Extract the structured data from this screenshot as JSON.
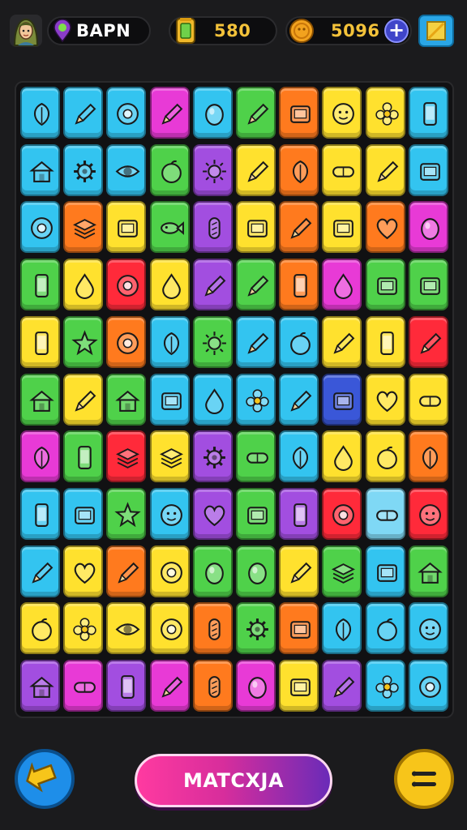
{
  "header": {
    "player_name": "BAPN",
    "gems": "580",
    "coins": "5096",
    "avatar_icon": "avatar-girl-icon",
    "gem_icon": "gem-jar-icon",
    "coin_icon": "coin-icon",
    "plus_icon": "plus-icon",
    "shop_icon": "square-shop-icon"
  },
  "board": {
    "rows": 11,
    "cols": 10,
    "tiles": [
      {
        "color": "#33c4f0",
        "icon": "leaf"
      },
      {
        "color": "#33c4f0",
        "icon": "pencil"
      },
      {
        "color": "#33c4f0",
        "icon": "donut"
      },
      {
        "color": "#e83ad6",
        "icon": "pencil"
      },
      {
        "color": "#33c4f0",
        "icon": "egg"
      },
      {
        "color": "#4fd14a",
        "icon": "pencil"
      },
      {
        "color": "#ff7a1e",
        "icon": "box"
      },
      {
        "color": "#ffe12e",
        "icon": "face"
      },
      {
        "color": "#ffe12e",
        "icon": "flower"
      },
      {
        "color": "#33c4f0",
        "icon": "phone"
      },
      {
        "color": "#33c4f0",
        "icon": "house"
      },
      {
        "color": "#33c4f0",
        "icon": "gear"
      },
      {
        "color": "#33c4f0",
        "icon": "eye"
      },
      {
        "color": "#4fd14a",
        "icon": "apple"
      },
      {
        "color": "#a24ee0",
        "icon": "sun"
      },
      {
        "color": "#ffe12e",
        "icon": "pencil"
      },
      {
        "color": "#ff7a1e",
        "icon": "leaf"
      },
      {
        "color": "#ffe12e",
        "icon": "capsule"
      },
      {
        "color": "#ffe12e",
        "icon": "pencil"
      },
      {
        "color": "#33c4f0",
        "icon": "box"
      },
      {
        "color": "#33c4f0",
        "icon": "donut"
      },
      {
        "color": "#ff7a1e",
        "icon": "layers"
      },
      {
        "color": "#ffe12e",
        "icon": "box"
      },
      {
        "color": "#4fd14a",
        "icon": "fish"
      },
      {
        "color": "#a24ee0",
        "icon": "bread"
      },
      {
        "color": "#ffe12e",
        "icon": "box"
      },
      {
        "color": "#ff7a1e",
        "icon": "pencil"
      },
      {
        "color": "#ffe12e",
        "icon": "box"
      },
      {
        "color": "#ff7a1e",
        "icon": "heart"
      },
      {
        "color": "#e83ad6",
        "icon": "egg"
      },
      {
        "color": "#4fd14a",
        "icon": "phone"
      },
      {
        "color": "#ffe12e",
        "icon": "drop"
      },
      {
        "color": "#ff2a3a",
        "icon": "donut"
      },
      {
        "color": "#ffe12e",
        "icon": "drop"
      },
      {
        "color": "#a24ee0",
        "icon": "pencil"
      },
      {
        "color": "#4fd14a",
        "icon": "pencil"
      },
      {
        "color": "#ff7a1e",
        "icon": "phone"
      },
      {
        "color": "#e83ad6",
        "icon": "drop"
      },
      {
        "color": "#4fd14a",
        "icon": "box"
      },
      {
        "color": "#4fd14a",
        "icon": "box"
      },
      {
        "color": "#ffe12e",
        "icon": "phone"
      },
      {
        "color": "#4fd14a",
        "icon": "star"
      },
      {
        "color": "#ff7a1e",
        "icon": "donut"
      },
      {
        "color": "#33c4f0",
        "icon": "leaf"
      },
      {
        "color": "#4fd14a",
        "icon": "sun"
      },
      {
        "color": "#33c4f0",
        "icon": "pencil"
      },
      {
        "color": "#33c4f0",
        "icon": "apple"
      },
      {
        "color": "#ffe12e",
        "icon": "pencil"
      },
      {
        "color": "#ffe12e",
        "icon": "phone"
      },
      {
        "color": "#ff2a3a",
        "icon": "pencil"
      },
      {
        "color": "#4fd14a",
        "icon": "house"
      },
      {
        "color": "#ffe12e",
        "icon": "pencil"
      },
      {
        "color": "#4fd14a",
        "icon": "house"
      },
      {
        "color": "#33c4f0",
        "icon": "box"
      },
      {
        "color": "#33c4f0",
        "icon": "drop"
      },
      {
        "color": "#33c4f0",
        "icon": "flower"
      },
      {
        "color": "#33c4f0",
        "icon": "pencil"
      },
      {
        "color": "#3a57d8",
        "icon": "box"
      },
      {
        "color": "#ffe12e",
        "icon": "heart"
      },
      {
        "color": "#ffe12e",
        "icon": "capsule"
      },
      {
        "color": "#e83ad6",
        "icon": "leaf"
      },
      {
        "color": "#4fd14a",
        "icon": "phone"
      },
      {
        "color": "#ff2a3a",
        "icon": "layers"
      },
      {
        "color": "#ffe12e",
        "icon": "layers"
      },
      {
        "color": "#a24ee0",
        "icon": "gear"
      },
      {
        "color": "#4fd14a",
        "icon": "capsule"
      },
      {
        "color": "#33c4f0",
        "icon": "leaf"
      },
      {
        "color": "#ffe12e",
        "icon": "drop"
      },
      {
        "color": "#ffe12e",
        "icon": "apple"
      },
      {
        "color": "#ff7a1e",
        "icon": "leaf"
      },
      {
        "color": "#33c4f0",
        "icon": "phone"
      },
      {
        "color": "#33c4f0",
        "icon": "box"
      },
      {
        "color": "#4fd14a",
        "icon": "star"
      },
      {
        "color": "#33c4f0",
        "icon": "face"
      },
      {
        "color": "#a24ee0",
        "icon": "heart"
      },
      {
        "color": "#4fd14a",
        "icon": "box"
      },
      {
        "color": "#a24ee0",
        "icon": "phone"
      },
      {
        "color": "#ff2a3a",
        "icon": "donut"
      },
      {
        "color": "#7fd8f5",
        "icon": "capsule"
      },
      {
        "color": "#ff2a3a",
        "icon": "face"
      },
      {
        "color": "#33c4f0",
        "icon": "pencil"
      },
      {
        "color": "#ffe12e",
        "icon": "heart"
      },
      {
        "color": "#ff7a1e",
        "icon": "pencil"
      },
      {
        "color": "#ffe12e",
        "icon": "donut"
      },
      {
        "color": "#4fd14a",
        "icon": "egg"
      },
      {
        "color": "#4fd14a",
        "icon": "egg"
      },
      {
        "color": "#ffe12e",
        "icon": "pencil"
      },
      {
        "color": "#4fd14a",
        "icon": "layers"
      },
      {
        "color": "#33c4f0",
        "icon": "box"
      },
      {
        "color": "#4fd14a",
        "icon": "house"
      },
      {
        "color": "#ffe12e",
        "icon": "apple"
      },
      {
        "color": "#ffe12e",
        "icon": "flower"
      },
      {
        "color": "#ffe12e",
        "icon": "eye"
      },
      {
        "color": "#ffe12e",
        "icon": "donut"
      },
      {
        "color": "#ff7a1e",
        "icon": "bread"
      },
      {
        "color": "#4fd14a",
        "icon": "gear"
      },
      {
        "color": "#ff7a1e",
        "icon": "box"
      },
      {
        "color": "#33c4f0",
        "icon": "leaf"
      },
      {
        "color": "#33c4f0",
        "icon": "apple"
      },
      {
        "color": "#33c4f0",
        "icon": "face"
      },
      {
        "color": "#a24ee0",
        "icon": "house"
      },
      {
        "color": "#e83ad6",
        "icon": "capsule"
      },
      {
        "color": "#a24ee0",
        "icon": "phone"
      },
      {
        "color": "#e83ad6",
        "icon": "pencil"
      },
      {
        "color": "#ff7a1e",
        "icon": "bread"
      },
      {
        "color": "#e83ad6",
        "icon": "egg"
      },
      {
        "color": "#ffe12e",
        "icon": "box"
      },
      {
        "color": "#a24ee0",
        "icon": "pencil"
      },
      {
        "color": "#33c4f0",
        "icon": "flower"
      },
      {
        "color": "#33c4f0",
        "icon": "donut"
      }
    ]
  },
  "footer": {
    "back_icon": "arrow-back-icon",
    "match_label": "MATCXJA",
    "menu_icon": "menu-lines-icon"
  }
}
